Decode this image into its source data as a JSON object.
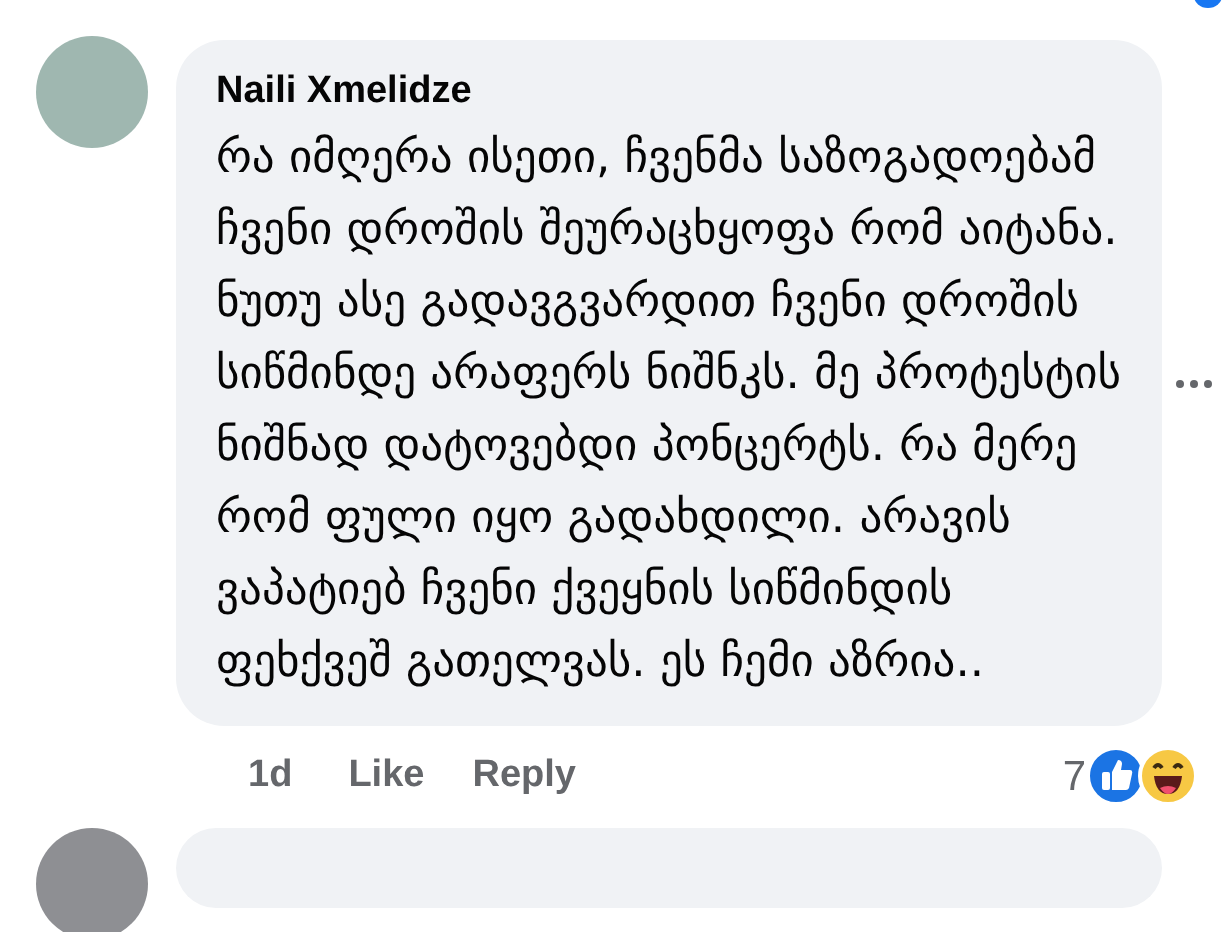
{
  "comment": {
    "author": "Naili Xmelidze",
    "text": "რა იმღერა ისეთი, ჩვენმა საზოგადოებამ ჩვენი დროშის შეურაცხყოფა რომ აიტანა. ნუთუ ასე გადავგვარდით ჩვენი დროშის სიწმინდე არაფერს ნიშნკს. მე პროტესტის ნიშნად დატოვებდი პონცერტს. რა მერე რომ ფული იყო გადახდილი. არავის ვაპატიებ ჩვენი ქვეყნის სიწმინდის ფეხქვეშ გათელვას. ეს ჩემი აზრია..",
    "time": "1d",
    "actions": [
      "Like",
      "Reply"
    ],
    "reaction_count": "7",
    "reactions": [
      {
        "kind": "like"
      },
      {
        "kind": "haha"
      }
    ]
  }
}
